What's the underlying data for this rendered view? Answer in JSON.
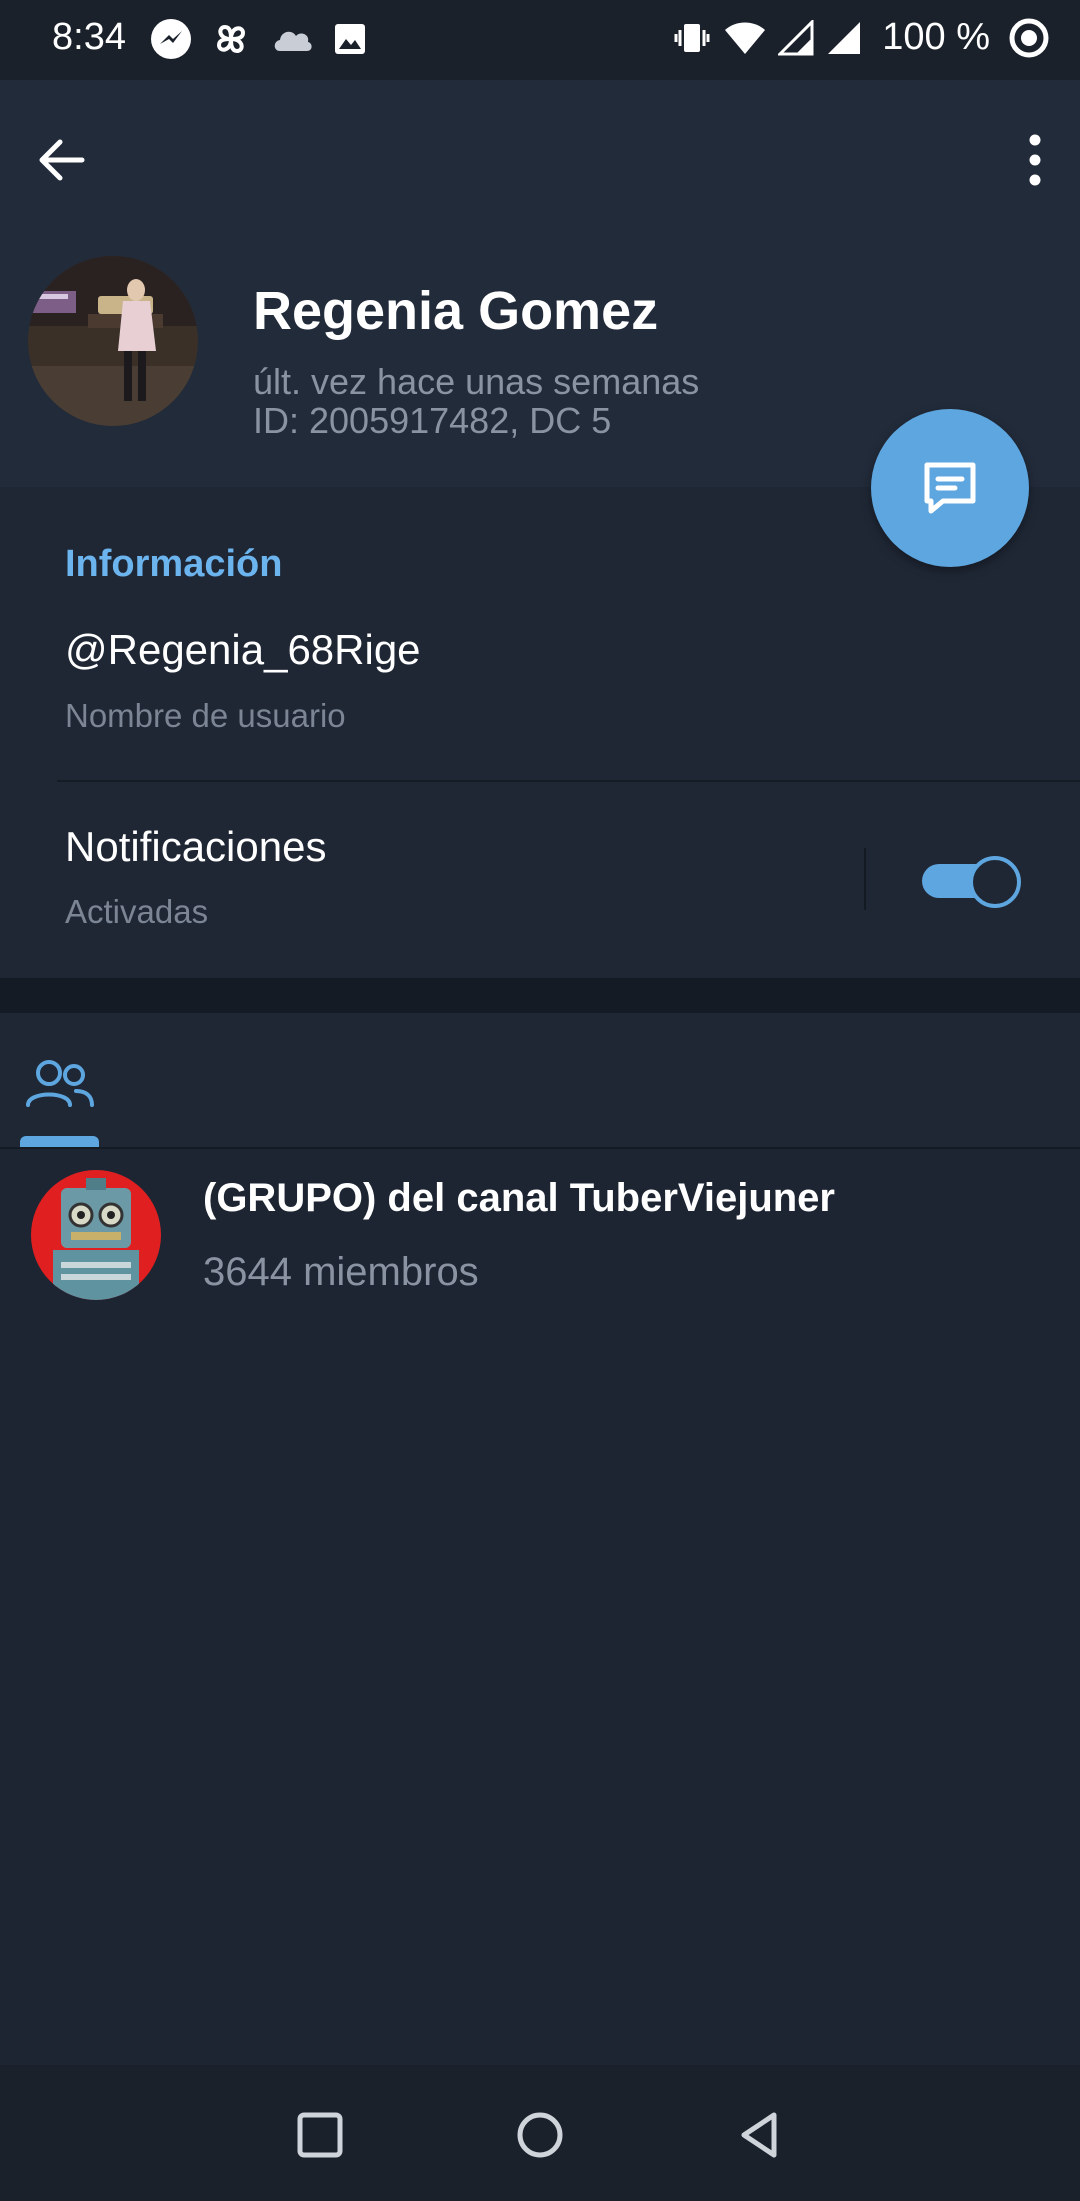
{
  "status_bar": {
    "time": "8:34",
    "battery": "100 %",
    "left_icons": [
      "messenger-icon",
      "pinwheel-icon",
      "cloud-icon",
      "image-icon"
    ],
    "right_icons": [
      "vibrate-icon",
      "wifi-icon",
      "signal-icon",
      "signal-icon",
      "battery-ring-icon"
    ]
  },
  "header": {
    "back_icon": "arrow-left-icon",
    "menu_icon": "more-vertical-icon"
  },
  "profile": {
    "name": "Regenia Gomez",
    "last_seen": "últ. vez hace unas semanas",
    "id_line": "ID: 2005917482, DC 5"
  },
  "fab": {
    "icon": "message-icon",
    "color": "#5ea6e0"
  },
  "info": {
    "section_title": "Información",
    "username": "@Regenia_68Rige",
    "username_label": "Nombre de usuario",
    "notifications_title": "Notificaciones",
    "notifications_state": "Activadas",
    "notifications_on": true
  },
  "tabs": [
    {
      "icon": "groups-icon",
      "selected": true
    }
  ],
  "groups": [
    {
      "name": "(GRUPO) del canal TuberViejuner",
      "members": "3644 miembros"
    }
  ],
  "nav_bar": {
    "buttons": [
      "recents-square-icon",
      "home-circle-icon",
      "back-triangle-icon"
    ]
  },
  "colors": {
    "accent": "#5ea6e0",
    "section_title": "#6cb4ee",
    "background": "#1d2533",
    "header": "#222b3a"
  }
}
